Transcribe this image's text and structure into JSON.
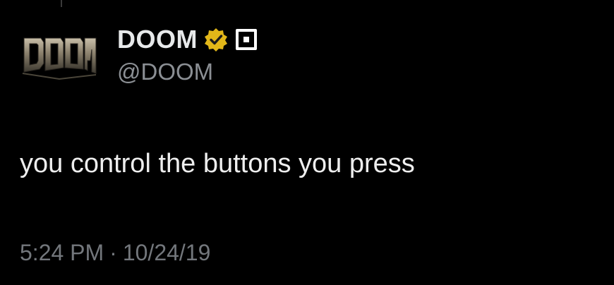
{
  "tweet": {
    "display_name": "DOOM",
    "handle": "@DOOM",
    "text": "you control the buttons you press",
    "time": "5:24 PM",
    "separator": "·",
    "date": "10/24/19",
    "avatar_logo_text": "DOOM",
    "verified_badge_icon": "gold-verified-badge-icon",
    "affiliate_icon": "affiliate-square-icon"
  },
  "colors": {
    "background": "#000000",
    "text_primary": "#e7e9ea",
    "text_secondary": "#8b8f94",
    "badge_gold": "#e2b719"
  }
}
